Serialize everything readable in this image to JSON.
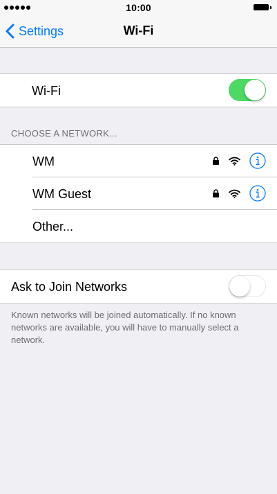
{
  "status_bar": {
    "time": "10:00",
    "signal_dots": 5
  },
  "nav": {
    "back_label": "Settings",
    "title": "Wi-Fi"
  },
  "wifi_toggle": {
    "label": "Wi-Fi",
    "state": "on"
  },
  "networks_section": {
    "header": "CHOOSE A NETWORK...",
    "networks": [
      {
        "name": "WM",
        "secured": true
      },
      {
        "name": "WM Guest",
        "secured": true
      }
    ],
    "other_label": "Other..."
  },
  "ask_to_join": {
    "label": "Ask to Join Networks",
    "state": "off",
    "footer": "Known networks will be joined automatically. If no known networks are available, you will have to manually select a network."
  },
  "colors": {
    "accent": "#007aff",
    "toggle_on": "#4cd964",
    "background": "#efeff4"
  },
  "icons": [
    "chevron-left-icon",
    "lock-icon",
    "wifi-icon",
    "info-icon"
  ]
}
